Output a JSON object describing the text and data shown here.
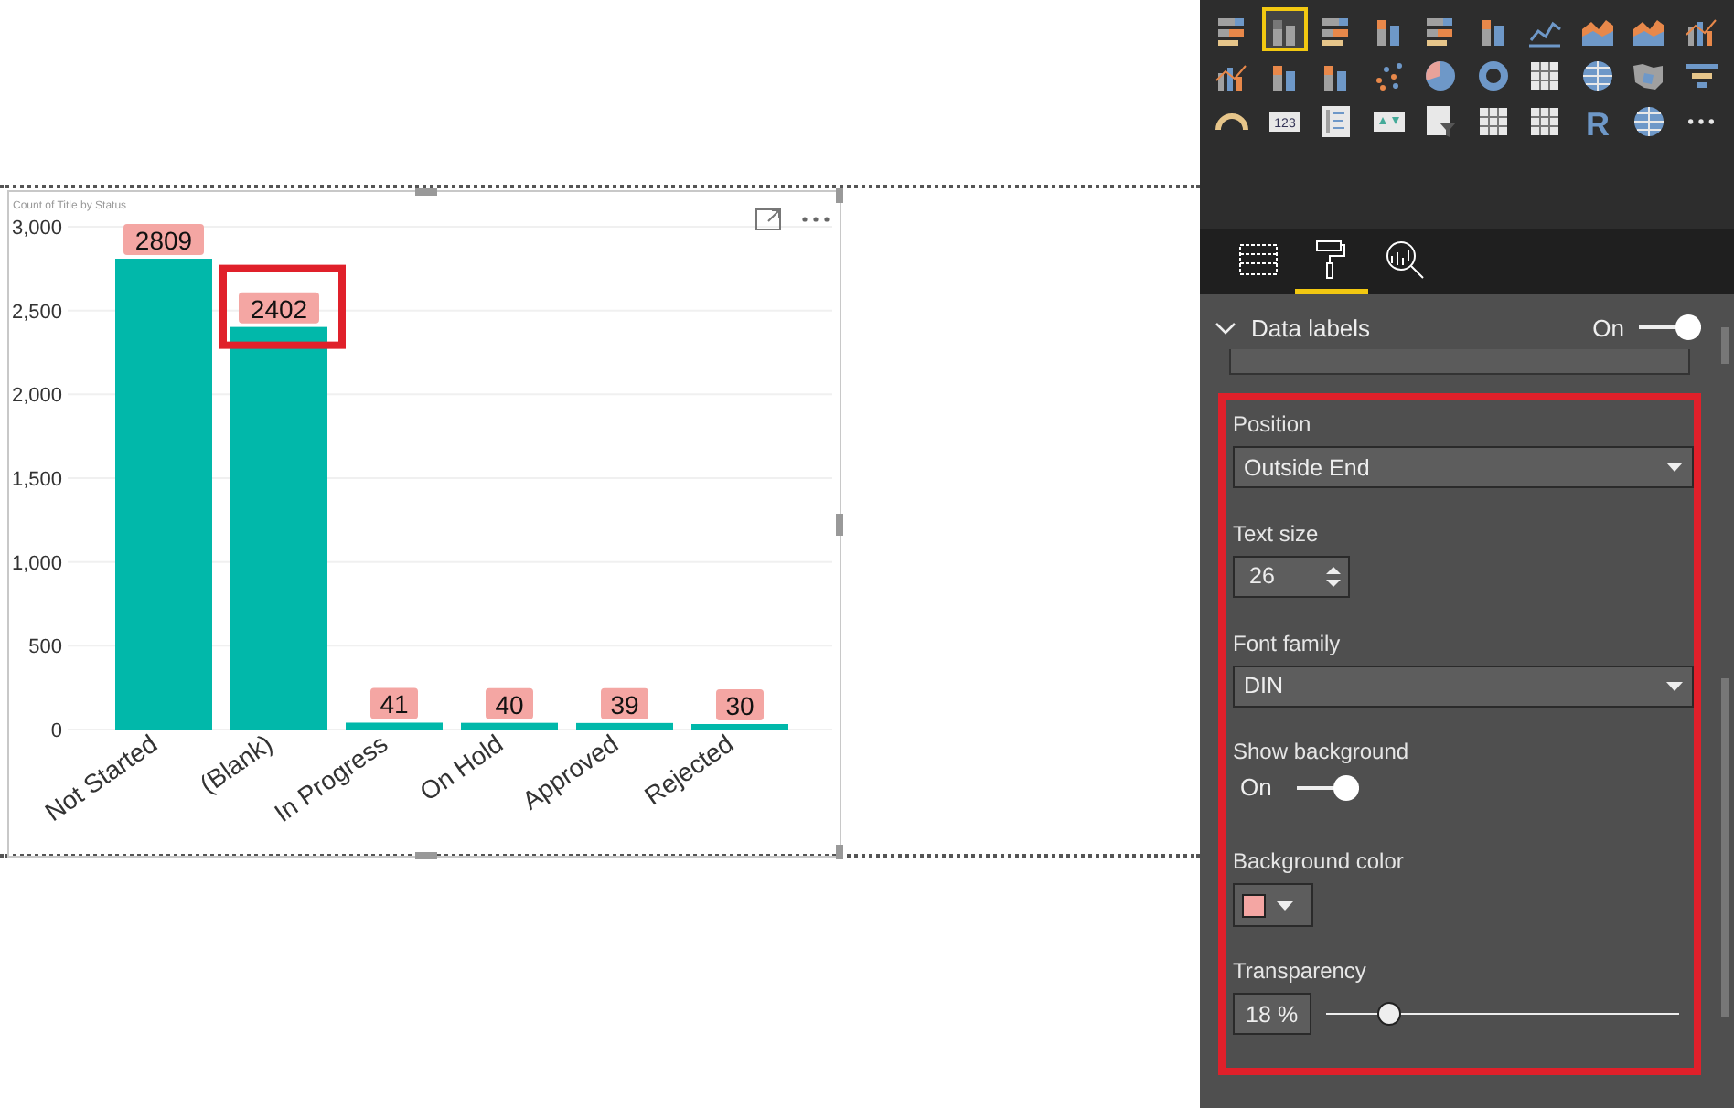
{
  "report_canvas": {
    "visual": {
      "title": "Count of Title by Status",
      "chart_data": {
        "type": "bar",
        "categories": [
          "Not Started",
          "(Blank)",
          "In Progress",
          "On Hold",
          "Approved",
          "Rejected"
        ],
        "values": [
          2809,
          2402,
          41,
          40,
          39,
          30
        ],
        "ylim": [
          0,
          3000
        ],
        "yticks": [
          {
            "value": 0,
            "label": "0"
          },
          {
            "value": 500,
            "label": "500"
          },
          {
            "value": 1000,
            "label": "1,000"
          },
          {
            "value": 1500,
            "label": "1,500"
          },
          {
            "value": 2000,
            "label": "2,000"
          },
          {
            "value": 2500,
            "label": "2,500"
          },
          {
            "value": 3000,
            "label": "3,000"
          }
        ],
        "value_labels": [
          "2809",
          "2402",
          "41",
          "40",
          "39",
          "30"
        ],
        "grid": true
      },
      "bar_highlights": [
        {
          "highlighted": false
        },
        {
          "highlighted": true
        },
        {
          "highlighted": false
        },
        {
          "highlighted": false
        },
        {
          "highlighted": false
        },
        {
          "highlighted": false
        }
      ]
    }
  },
  "visualizations_pane": {
    "gallery": [
      {
        "kind": "hbar",
        "selected": false
      },
      {
        "kind": "column",
        "selected": true
      },
      {
        "kind": "hbar",
        "selected": false
      },
      {
        "kind": "column",
        "selected": false
      },
      {
        "kind": "hbar",
        "selected": false
      },
      {
        "kind": "column",
        "selected": false
      },
      {
        "kind": "line",
        "selected": false
      },
      {
        "kind": "area",
        "selected": false
      },
      {
        "kind": "area",
        "selected": false
      },
      {
        "kind": "combo",
        "selected": false
      },
      {
        "kind": "combo",
        "selected": false
      },
      {
        "kind": "column",
        "selected": false
      },
      {
        "kind": "column",
        "selected": false
      },
      {
        "kind": "scatter",
        "selected": false
      },
      {
        "kind": "pie",
        "selected": false
      },
      {
        "kind": "donut",
        "selected": false
      },
      {
        "kind": "grid",
        "selected": false
      },
      {
        "kind": "globe",
        "selected": false
      },
      {
        "kind": "map",
        "selected": false
      },
      {
        "kind": "funnel",
        "selected": false
      },
      {
        "kind": "gauge",
        "selected": false
      },
      {
        "kind": "card",
        "label": "123",
        "selected": false
      },
      {
        "kind": "list",
        "selected": false
      },
      {
        "kind": "kpi",
        "selected": false
      },
      {
        "kind": "slicer",
        "selected": false
      },
      {
        "kind": "grid",
        "selected": false
      },
      {
        "kind": "grid",
        "selected": false
      },
      {
        "kind": "letter",
        "label": "R",
        "selected": false
      },
      {
        "kind": "globe",
        "selected": false
      },
      {
        "kind": "more",
        "selected": false
      }
    ],
    "pane_tabs": [
      {
        "kind": "fields",
        "selected": false
      },
      {
        "kind": "format",
        "selected": true
      },
      {
        "kind": "analytics",
        "selected": false
      }
    ],
    "format_section": {
      "title": "Data labels",
      "expanded": true,
      "toggle_label": "On",
      "on": true,
      "settings": {
        "highlighted": true,
        "items": [
          {
            "kind": "dropdown",
            "label": "Position",
            "value": "Outside End"
          },
          {
            "kind": "spinner",
            "label": "Text size",
            "value": "26"
          },
          {
            "kind": "dropdown",
            "label": "Font family",
            "value": "DIN"
          },
          {
            "kind": "toggle",
            "label": "Show background",
            "toggle_label": "On",
            "on": true
          },
          {
            "kind": "color",
            "label": "Background color",
            "color": "#f4a6a3"
          },
          {
            "kind": "slider",
            "label": "Transparency",
            "value": "18",
            "unit": "%",
            "level": 0.18
          }
        ]
      }
    }
  }
}
